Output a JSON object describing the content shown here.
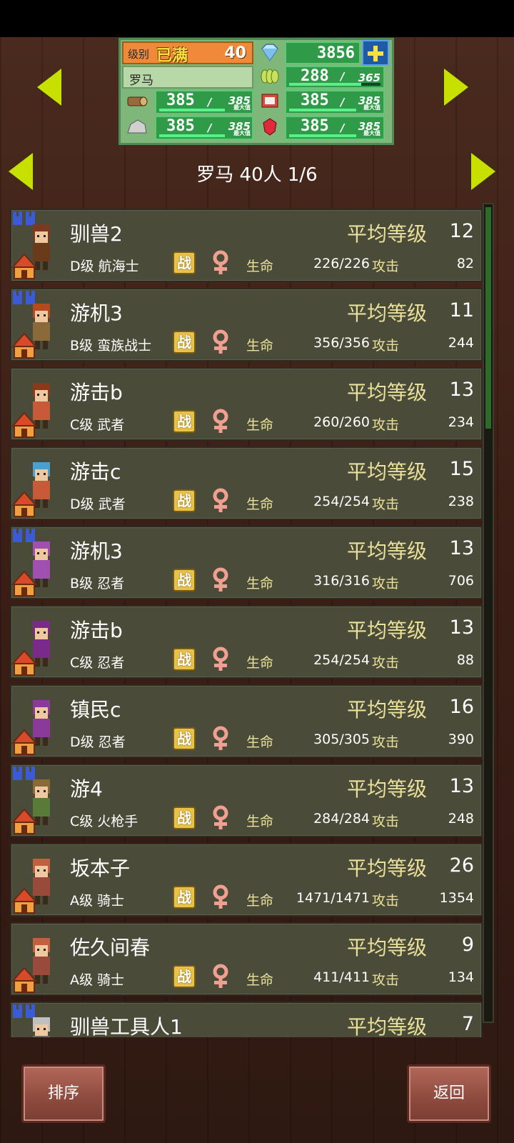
{
  "header": {
    "level_label": "级别",
    "level_badge": "已满",
    "level_value": "40",
    "gems": "3856",
    "town_name": "罗马",
    "food": "288",
    "food_max": "365",
    "wood": "385",
    "wood_max": "385",
    "wood_max_sub": "最大值",
    "cloth": "385",
    "cloth_max": "385",
    "cloth_max_sub": "最大值",
    "stone": "385",
    "stone_max": "385",
    "stone_max_sub": "最大值",
    "ruby": "385",
    "ruby_max": "385",
    "ruby_max_sub": "最大值",
    "icons": [
      "diamond-icon",
      "plus-icon",
      "wheat-icon",
      "log-icon",
      "cloth-icon",
      "stone-icon",
      "ruby-icon",
      "arrow-left-icon",
      "arrow-right-icon"
    ]
  },
  "title": {
    "text": "罗马  40人 1/6"
  },
  "labels": {
    "avg_level": "平均等级",
    "battle": "战",
    "hp": "生命",
    "attack": "攻击"
  },
  "members": [
    {
      "name": "驯兽2",
      "level": "12",
      "grade": "D级 航海士",
      "hp": "226/226",
      "attack": "82",
      "group": true,
      "hair": "#7a3a22",
      "skin": "#f0c8a0",
      "cloth": "#6a3a1a"
    },
    {
      "name": "游机3",
      "level": "11",
      "grade": "B级 蛮族战士",
      "hp": "356/356",
      "attack": "244",
      "group": true,
      "hair": "#b54a22",
      "skin": "#f0c8a0",
      "cloth": "#8a6a3a"
    },
    {
      "name": "游击b",
      "level": "13",
      "grade": "C级 武者",
      "hp": "260/260",
      "attack": "234",
      "group": false,
      "hair": "#8a3a1a",
      "skin": "#f0c8a0",
      "cloth": "#c85a3a"
    },
    {
      "name": "游击c",
      "level": "15",
      "grade": "D级 武者",
      "hp": "254/254",
      "attack": "238",
      "group": false,
      "hair": "#4aa0d0",
      "skin": "#f0c8a0",
      "cloth": "#c85a3a"
    },
    {
      "name": "游机3",
      "level": "13",
      "grade": "B级 忍者",
      "hp": "316/316",
      "attack": "706",
      "group": true,
      "hair": "#a050b0",
      "skin": "#f0c8a0",
      "cloth": "#a050b0"
    },
    {
      "name": "游击b",
      "level": "13",
      "grade": "C级 忍者",
      "hp": "254/254",
      "attack": "88",
      "group": false,
      "hair": "#7a2a8a",
      "skin": "#f0c8a0",
      "cloth": "#7a2a8a"
    },
    {
      "name": "镇民c",
      "level": "16",
      "grade": "D级 忍者",
      "hp": "305/305",
      "attack": "390",
      "group": false,
      "hair": "#8a3a9a",
      "skin": "#f0c8a0",
      "cloth": "#8a3a9a"
    },
    {
      "name": "游4",
      "level": "13",
      "grade": "C级 火枪手",
      "hp": "284/284",
      "attack": "248",
      "group": true,
      "hair": "#8a6a3a",
      "skin": "#f0c8a0",
      "cloth": "#5a7a3a"
    },
    {
      "name": "坂本子",
      "level": "26",
      "grade": "A级 骑士",
      "hp": "1471/1471",
      "attack": "1354",
      "group": false,
      "hair": "#c06040",
      "skin": "#f0c8a0",
      "cloth": "#9a4a3a"
    },
    {
      "name": "佐久间春",
      "level": "9",
      "grade": "A级 骑士",
      "hp": "411/411",
      "attack": "134",
      "group": false,
      "hair": "#c06040",
      "skin": "#f0c8a0",
      "cloth": "#9a4a3a"
    },
    {
      "name": "驯兽工具人1",
      "level": "7",
      "grade": "",
      "hp": "",
      "attack": "",
      "group": true,
      "hair": "#c0c0c0",
      "skin": "#f0c8a0",
      "cloth": "#6a6a6a"
    }
  ],
  "buttons": {
    "sort": "排序",
    "back": "返回"
  },
  "colors": {
    "accent_green": "#c8e000",
    "row_bg": "#4b4b3a",
    "label_yellow": "#e9e09a"
  }
}
